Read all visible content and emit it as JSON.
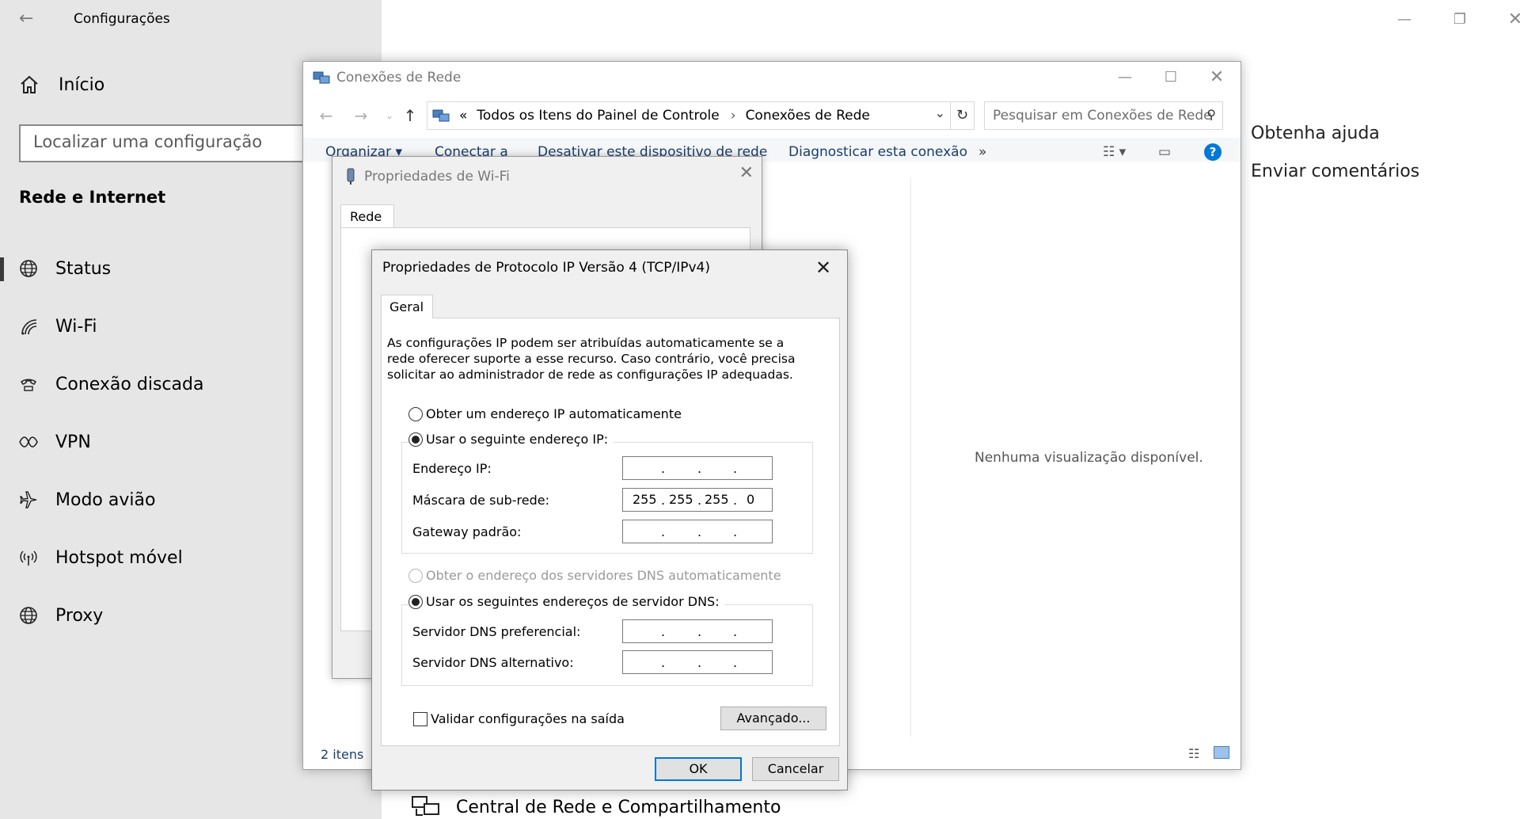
{
  "settings": {
    "app_title": "Configurações",
    "home_label": "Início",
    "search_placeholder": "Localizar uma configuração",
    "section_title": "Rede e Internet",
    "nav_items": [
      {
        "label": "Status",
        "icon": "globe-icon"
      },
      {
        "label": "Wi-Fi",
        "icon": "wifi-icon"
      },
      {
        "label": "Conexão discada",
        "icon": "dialup-icon"
      },
      {
        "label": "VPN",
        "icon": "vpn-icon"
      },
      {
        "label": "Modo avião",
        "icon": "airplane-icon"
      },
      {
        "label": "Hotspot móvel",
        "icon": "hotspot-icon"
      },
      {
        "label": "Proxy",
        "icon": "globe-icon"
      }
    ],
    "related": {
      "help": "Obtenha ajuda",
      "feedback": "Enviar comentários"
    },
    "bottom_link": "Central de Rede e Compartilhamento"
  },
  "explorer": {
    "title": "Conexões de Rede",
    "address": {
      "prefix": "«",
      "segment1": "Todos os Itens do Painel de Controle",
      "segment2": "Conexões de Rede"
    },
    "search_placeholder": "Pesquisar em Conexões de Rede",
    "commands": {
      "organize": "Organizar ▾",
      "connect": "Conectar a",
      "disable": "Desativar este dispositivo de rede",
      "diagnose": "Diagnosticar esta conexão",
      "more": "»"
    },
    "no_preview": "Nenhuma visualização disponível.",
    "item_count": "2 itens"
  },
  "wifi_dialog": {
    "title": "Propriedades de Wi-Fi",
    "tab": "Rede"
  },
  "ipv4_dialog": {
    "title": "Propriedades de Protocolo IP Versão 4 (TCP/IPv4)",
    "tab": "Geral",
    "description": "As configurações IP podem ser atribuídas automaticamente se a rede oferecer suporte a esse recurso. Caso contrário, você precisa solicitar ao administrador de rede as configurações IP adequadas.",
    "radio_auto_ip": "Obter um endereço IP automaticamente",
    "radio_manual_ip": "Usar o seguinte endereço IP:",
    "ip_label": "Endereço IP:",
    "mask_label": "Máscara de sub-rede:",
    "gateway_label": "Gateway padrão:",
    "mask_octets": [
      "255",
      "255",
      "255",
      "0"
    ],
    "radio_auto_dns": "Obter o endereço dos servidores DNS automaticamente",
    "radio_manual_dns": "Usar os seguintes endereços de servidor DNS:",
    "dns_pref_label": "Servidor DNS preferencial:",
    "dns_alt_label": "Servidor DNS alternativo:",
    "validate_label": "Validar configurações na saída",
    "advanced_button": "Avançado...",
    "ok_button": "OK",
    "cancel_button": "Cancelar",
    "selected_ip_mode": "manual",
    "selected_dns_mode": "manual",
    "validate_checked": false
  },
  "colors": {
    "accent": "#0078d7",
    "sidebar_bg": "#e6e6e6",
    "dialog_bg": "#f0f0f0",
    "link": "#1a3e6e"
  }
}
